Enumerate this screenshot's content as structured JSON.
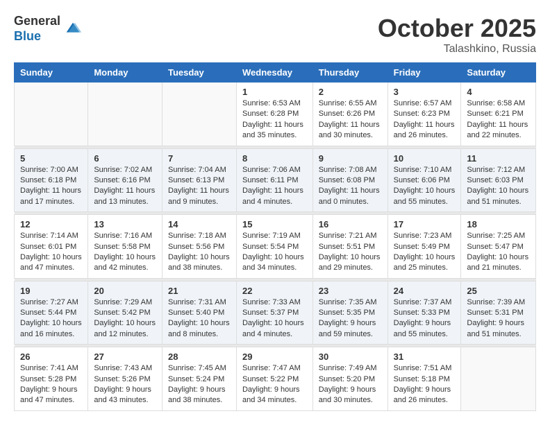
{
  "logo": {
    "general": "General",
    "blue": "Blue"
  },
  "title": {
    "month": "October 2025",
    "location": "Talashkino, Russia"
  },
  "headers": [
    "Sunday",
    "Monday",
    "Tuesday",
    "Wednesday",
    "Thursday",
    "Friday",
    "Saturday"
  ],
  "weeks": [
    {
      "days": [
        {
          "num": "",
          "info": ""
        },
        {
          "num": "",
          "info": ""
        },
        {
          "num": "",
          "info": ""
        },
        {
          "num": "1",
          "info": "Sunrise: 6:53 AM\nSunset: 6:28 PM\nDaylight: 11 hours\nand 35 minutes."
        },
        {
          "num": "2",
          "info": "Sunrise: 6:55 AM\nSunset: 6:26 PM\nDaylight: 11 hours\nand 30 minutes."
        },
        {
          "num": "3",
          "info": "Sunrise: 6:57 AM\nSunset: 6:23 PM\nDaylight: 11 hours\nand 26 minutes."
        },
        {
          "num": "4",
          "info": "Sunrise: 6:58 AM\nSunset: 6:21 PM\nDaylight: 11 hours\nand 22 minutes."
        }
      ]
    },
    {
      "days": [
        {
          "num": "5",
          "info": "Sunrise: 7:00 AM\nSunset: 6:18 PM\nDaylight: 11 hours\nand 17 minutes."
        },
        {
          "num": "6",
          "info": "Sunrise: 7:02 AM\nSunset: 6:16 PM\nDaylight: 11 hours\nand 13 minutes."
        },
        {
          "num": "7",
          "info": "Sunrise: 7:04 AM\nSunset: 6:13 PM\nDaylight: 11 hours\nand 9 minutes."
        },
        {
          "num": "8",
          "info": "Sunrise: 7:06 AM\nSunset: 6:11 PM\nDaylight: 11 hours\nand 4 minutes."
        },
        {
          "num": "9",
          "info": "Sunrise: 7:08 AM\nSunset: 6:08 PM\nDaylight: 11 hours\nand 0 minutes."
        },
        {
          "num": "10",
          "info": "Sunrise: 7:10 AM\nSunset: 6:06 PM\nDaylight: 10 hours\nand 55 minutes."
        },
        {
          "num": "11",
          "info": "Sunrise: 7:12 AM\nSunset: 6:03 PM\nDaylight: 10 hours\nand 51 minutes."
        }
      ]
    },
    {
      "days": [
        {
          "num": "12",
          "info": "Sunrise: 7:14 AM\nSunset: 6:01 PM\nDaylight: 10 hours\nand 47 minutes."
        },
        {
          "num": "13",
          "info": "Sunrise: 7:16 AM\nSunset: 5:58 PM\nDaylight: 10 hours\nand 42 minutes."
        },
        {
          "num": "14",
          "info": "Sunrise: 7:18 AM\nSunset: 5:56 PM\nDaylight: 10 hours\nand 38 minutes."
        },
        {
          "num": "15",
          "info": "Sunrise: 7:19 AM\nSunset: 5:54 PM\nDaylight: 10 hours\nand 34 minutes."
        },
        {
          "num": "16",
          "info": "Sunrise: 7:21 AM\nSunset: 5:51 PM\nDaylight: 10 hours\nand 29 minutes."
        },
        {
          "num": "17",
          "info": "Sunrise: 7:23 AM\nSunset: 5:49 PM\nDaylight: 10 hours\nand 25 minutes."
        },
        {
          "num": "18",
          "info": "Sunrise: 7:25 AM\nSunset: 5:47 PM\nDaylight: 10 hours\nand 21 minutes."
        }
      ]
    },
    {
      "days": [
        {
          "num": "19",
          "info": "Sunrise: 7:27 AM\nSunset: 5:44 PM\nDaylight: 10 hours\nand 16 minutes."
        },
        {
          "num": "20",
          "info": "Sunrise: 7:29 AM\nSunset: 5:42 PM\nDaylight: 10 hours\nand 12 minutes."
        },
        {
          "num": "21",
          "info": "Sunrise: 7:31 AM\nSunset: 5:40 PM\nDaylight: 10 hours\nand 8 minutes."
        },
        {
          "num": "22",
          "info": "Sunrise: 7:33 AM\nSunset: 5:37 PM\nDaylight: 10 hours\nand 4 minutes."
        },
        {
          "num": "23",
          "info": "Sunrise: 7:35 AM\nSunset: 5:35 PM\nDaylight: 9 hours\nand 59 minutes."
        },
        {
          "num": "24",
          "info": "Sunrise: 7:37 AM\nSunset: 5:33 PM\nDaylight: 9 hours\nand 55 minutes."
        },
        {
          "num": "25",
          "info": "Sunrise: 7:39 AM\nSunset: 5:31 PM\nDaylight: 9 hours\nand 51 minutes."
        }
      ]
    },
    {
      "days": [
        {
          "num": "26",
          "info": "Sunrise: 7:41 AM\nSunset: 5:28 PM\nDaylight: 9 hours\nand 47 minutes."
        },
        {
          "num": "27",
          "info": "Sunrise: 7:43 AM\nSunset: 5:26 PM\nDaylight: 9 hours\nand 43 minutes."
        },
        {
          "num": "28",
          "info": "Sunrise: 7:45 AM\nSunset: 5:24 PM\nDaylight: 9 hours\nand 38 minutes."
        },
        {
          "num": "29",
          "info": "Sunrise: 7:47 AM\nSunset: 5:22 PM\nDaylight: 9 hours\nand 34 minutes."
        },
        {
          "num": "30",
          "info": "Sunrise: 7:49 AM\nSunset: 5:20 PM\nDaylight: 9 hours\nand 30 minutes."
        },
        {
          "num": "31",
          "info": "Sunrise: 7:51 AM\nSunset: 5:18 PM\nDaylight: 9 hours\nand 26 minutes."
        },
        {
          "num": "",
          "info": ""
        }
      ]
    }
  ]
}
